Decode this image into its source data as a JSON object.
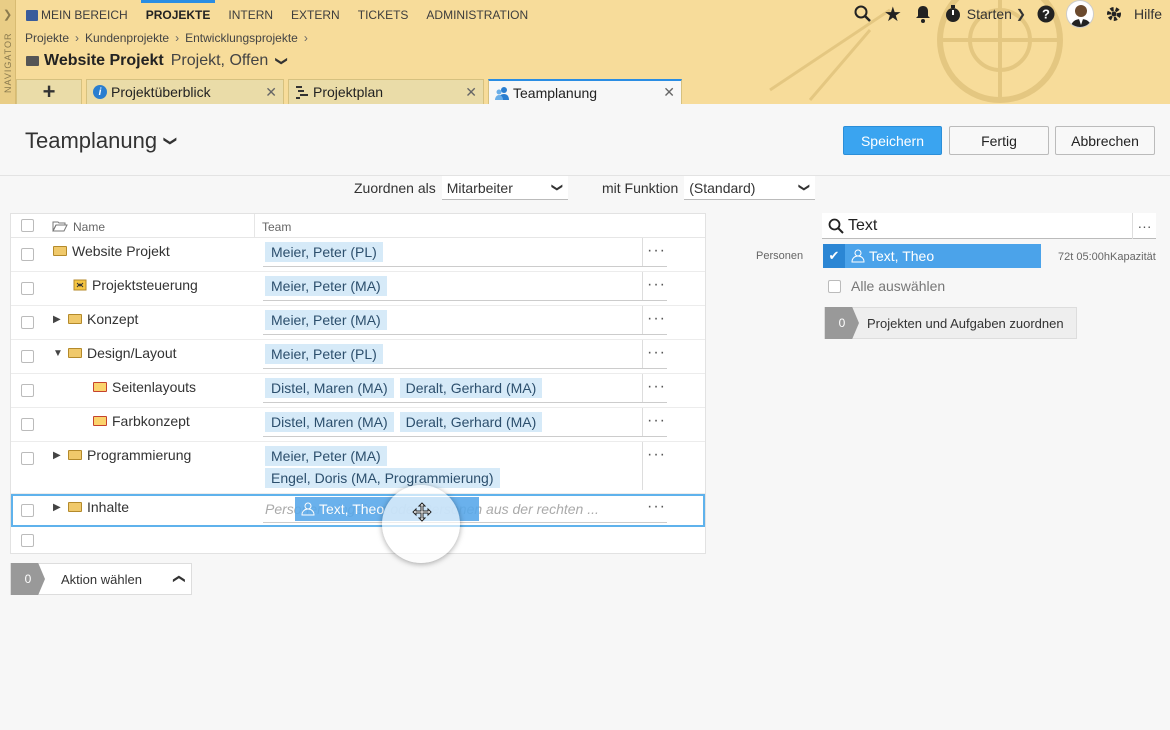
{
  "nav": {
    "navigator_label": "NAVIGATOR",
    "items": [
      "MEIN BEREICH",
      "PROJEKTE",
      "INTERN",
      "EXTERN",
      "TICKETS",
      "ADMINISTRATION"
    ],
    "active": "PROJEKTE",
    "start_label": "Starten",
    "help_label": "Hilfe"
  },
  "breadcrumb": [
    "Projekte",
    "Kundenprojekte",
    "Entwicklungsprojekte"
  ],
  "project": {
    "title": "Website Projekt",
    "subtitle": "Projekt, Offen"
  },
  "tabs": [
    {
      "label": "+"
    },
    {
      "label": "Projektüberblick"
    },
    {
      "label": "Projektplan"
    },
    {
      "label": "Teamplanung",
      "active": true
    }
  ],
  "page": {
    "title": "Teamplanung",
    "save": "Speichern",
    "done": "Fertig",
    "cancel": "Abbrechen"
  },
  "assign": {
    "as_label": "Zuordnen als",
    "as_value": "Mitarbeiter",
    "function_label": "mit Funktion",
    "function_value": "(Standard)"
  },
  "grid": {
    "col_name": "Name",
    "col_team": "Team",
    "rows": [
      {
        "name": "Website Projekt",
        "team": [
          "Meier, Peter (PL)"
        ]
      },
      {
        "name": "Projektsteuerung",
        "team": [
          "Meier, Peter (MA)"
        ]
      },
      {
        "name": "Konzept",
        "team": [
          "Meier, Peter (MA)"
        ]
      },
      {
        "name": "Design/Layout",
        "team": [
          "Meier, Peter (PL)"
        ]
      },
      {
        "name": "Seitenlayouts",
        "team": [
          "Distel, Maren (MA)",
          "Deralt, Gerhard (MA)"
        ]
      },
      {
        "name": "Farbkonzept",
        "team": [
          "Distel, Maren (MA)",
          "Deralt, Gerhard (MA)"
        ]
      },
      {
        "name": "Programmierung",
        "team": [
          "Meier, Peter (MA)",
          "Engel, Doris (MA, Programmierung)"
        ]
      },
      {
        "name": "Inhalte",
        "placeholder": "Personen eingeben oder Personen aus der rechten ..."
      }
    ],
    "drag_label": "Text, Theo"
  },
  "action": {
    "count": "0",
    "label": "Aktion wählen"
  },
  "right": {
    "search_value": "Text",
    "section_label": "Personen",
    "person": "Text, Theo",
    "capacity": "72t 05:00hKapazität",
    "select_all": "Alle auswählen",
    "assign_count": "0",
    "assign_label": "Projekten und Aufgaben zuordnen"
  },
  "colors": {
    "accent": "#3aa4f0",
    "header": "#f7dc9a",
    "chip": "#d6eaf8"
  }
}
